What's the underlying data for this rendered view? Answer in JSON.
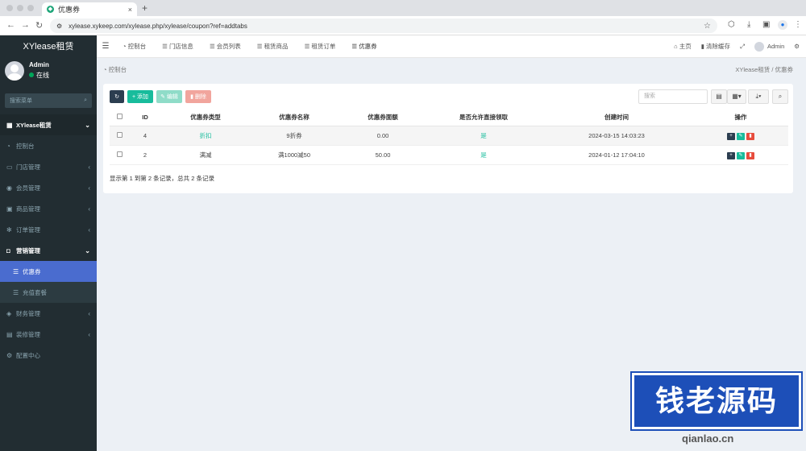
{
  "browser": {
    "tab_title": "优惠券",
    "tab_close": "×",
    "new_tab": "+",
    "url": "xylease.xykeep.com/xylease.php/xylease/coupon?ref=addtabs"
  },
  "sidebar": {
    "logo": "XYlease租赁",
    "user_name": "Admin",
    "user_status": "在线",
    "search_placeholder": "搜索菜单",
    "items": [
      {
        "label": "XYlease租赁",
        "icon": "grid-icon",
        "arrow": "⌄"
      },
      {
        "label": "控制台",
        "icon": "dashboard-icon",
        "arrow": ""
      },
      {
        "label": "门店管理",
        "icon": "store-icon",
        "arrow": "‹"
      },
      {
        "label": "会员管理",
        "icon": "user-icon",
        "arrow": "‹"
      },
      {
        "label": "商品管理",
        "icon": "cubes-icon",
        "arrow": "‹"
      },
      {
        "label": "订单管理",
        "icon": "gear-icon",
        "arrow": "‹"
      },
      {
        "label": "营销管理",
        "icon": "gift-icon",
        "arrow": "⌄"
      },
      {
        "label": "优惠券",
        "icon": "list-icon",
        "arrow": ""
      },
      {
        "label": "充值套餐",
        "icon": "list-icon",
        "arrow": ""
      },
      {
        "label": "财务管理",
        "icon": "finance-icon",
        "arrow": "‹"
      },
      {
        "label": "装修管理",
        "icon": "layout-icon",
        "arrow": "‹"
      },
      {
        "label": "配置中心",
        "icon": "cog-icon",
        "arrow": ""
      }
    ]
  },
  "topnav": {
    "tabs": [
      "控制台",
      "门店信息",
      "会员列表",
      "租赁商品",
      "租赁订单",
      "优惠券"
    ],
    "home": "主页",
    "clear_cache": "清除缓存",
    "admin": "Admin"
  },
  "breadcrumb": {
    "left": "控制台",
    "right": "XYlease租赁  /  优惠券"
  },
  "toolbar": {
    "add": "添加",
    "edit": "编辑",
    "delete": "删除",
    "search_placeholder": "搜索"
  },
  "table": {
    "headers": [
      "ID",
      "优惠券类型",
      "优惠券名称",
      "优惠券面额",
      "是否允许直接领取",
      "创建时间",
      "操作"
    ],
    "rows": [
      {
        "id": "4",
        "type": "折扣",
        "name": "9折券",
        "amount": "0.00",
        "allow": "是",
        "created": "2024-03-15 14:03:23"
      },
      {
        "id": "2",
        "type": "满减",
        "name": "满1000减50",
        "amount": "50.00",
        "allow": "是",
        "created": "2024-01-12 17:04:10"
      }
    ]
  },
  "summary": "显示第 1 到第 2 条记录，总共 2 条记录",
  "watermark": {
    "main": "钱老源码",
    "sub": "qianlao.cn"
  },
  "colors": {
    "sidebar_bg": "#222d32",
    "active_menu": "#4a6ccf",
    "add_btn": "#18bc9c",
    "delete_btn": "#e74c3c",
    "refresh_btn": "#2c3e50"
  }
}
